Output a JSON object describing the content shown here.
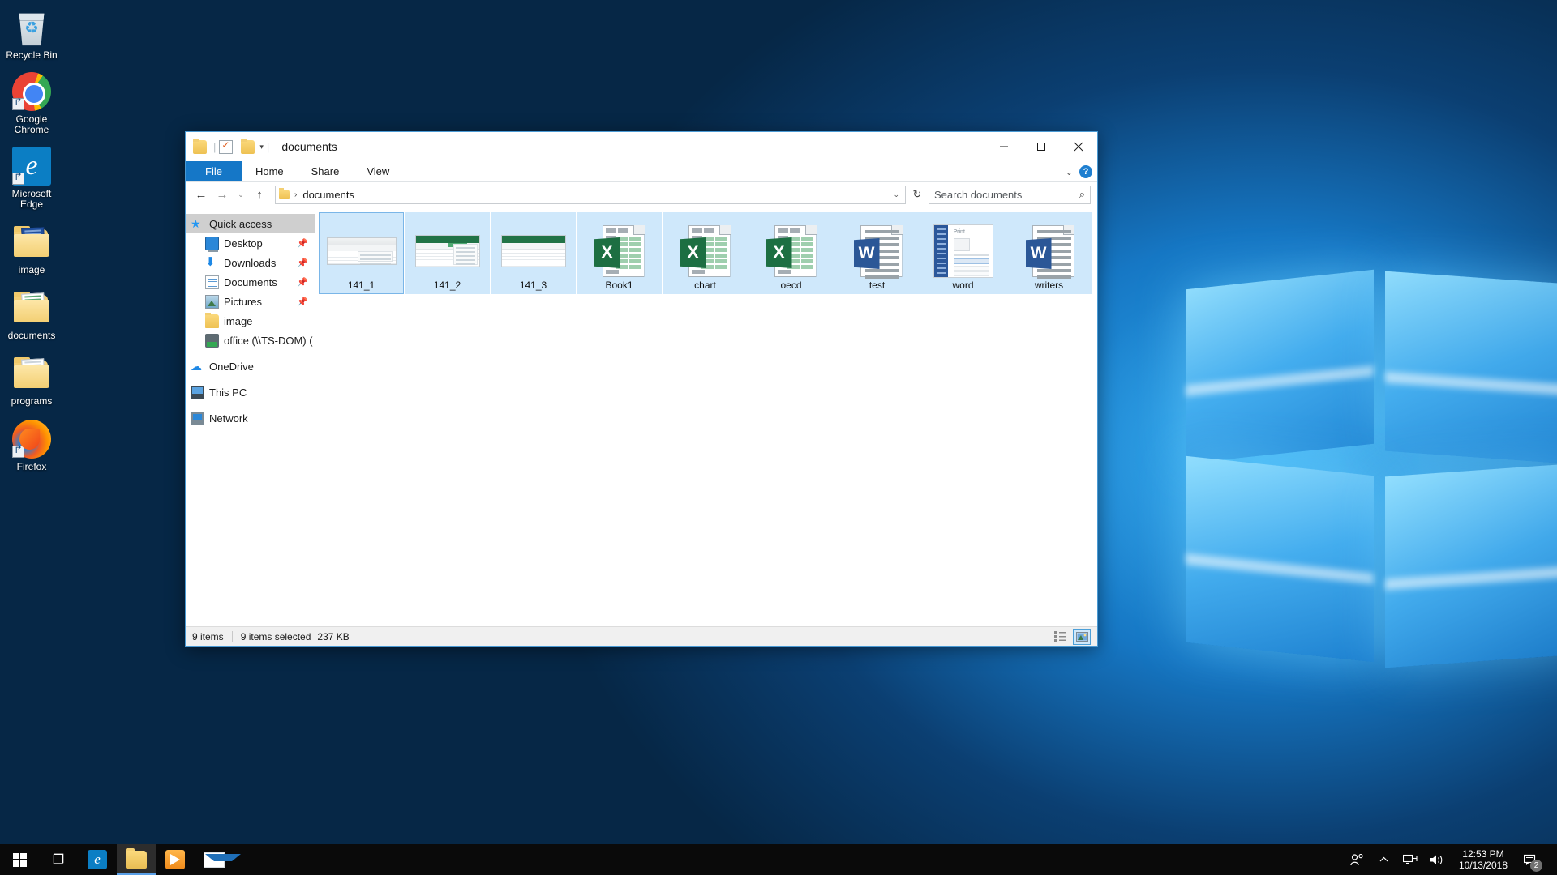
{
  "desktop": {
    "icons": [
      {
        "label": "Recycle Bin",
        "icon": "recycle-bin-icon"
      },
      {
        "label": "Google Chrome",
        "icon": "chrome-icon"
      },
      {
        "label": "Microsoft Edge",
        "icon": "edge-icon"
      },
      {
        "label": "image",
        "icon": "folder-icon"
      },
      {
        "label": "documents",
        "icon": "folder-icon"
      },
      {
        "label": "programs",
        "icon": "folder-icon"
      },
      {
        "label": "Firefox",
        "icon": "firefox-icon"
      }
    ]
  },
  "explorer": {
    "title": "documents",
    "quick_access_toolbar": {
      "folder_icon": "folder-icon",
      "properties_icon": "properties-icon",
      "new_folder_icon": "new-folder-icon",
      "customize_caret": "▾"
    },
    "window_controls": {
      "minimize": "minimize-icon",
      "maximize": "maximize-icon",
      "close": "close-icon"
    },
    "ribbon": {
      "tabs": [
        "File",
        "Home",
        "Share",
        "View"
      ],
      "collapse_caret": "⌄",
      "help_label": "?"
    },
    "address_bar": {
      "back": "←",
      "forward": "→",
      "recent": "⌄",
      "up": "↑",
      "crumb_folder_icon": "folder-icon",
      "crumb_separator": "›",
      "path": "documents",
      "dropdown_caret": "⌄",
      "refresh": "↻"
    },
    "search": {
      "placeholder": "Search documents",
      "value": "",
      "icon": "search-icon"
    },
    "nav_pane": {
      "items": [
        {
          "label": "Quick access",
          "icon": "quick-access-star-icon",
          "selected": true,
          "child": false,
          "pinned": false
        },
        {
          "label": "Desktop",
          "icon": "desktop-icon",
          "selected": false,
          "child": true,
          "pinned": true
        },
        {
          "label": "Downloads",
          "icon": "downloads-icon",
          "selected": false,
          "child": true,
          "pinned": true
        },
        {
          "label": "Documents",
          "icon": "documents-icon",
          "selected": false,
          "child": true,
          "pinned": true
        },
        {
          "label": "Pictures",
          "icon": "pictures-icon",
          "selected": false,
          "child": true,
          "pinned": true
        },
        {
          "label": "image",
          "icon": "folder-icon",
          "selected": false,
          "child": true,
          "pinned": false
        },
        {
          "label": "office (\\\\TS-DOM) (",
          "icon": "network-drive-icon",
          "selected": false,
          "child": true,
          "pinned": false
        },
        {
          "label": "OneDrive",
          "icon": "onedrive-icon",
          "selected": false,
          "child": false,
          "pinned": false
        },
        {
          "label": "This PC",
          "icon": "this-pc-icon",
          "selected": false,
          "child": false,
          "pinned": false
        },
        {
          "label": "Network",
          "icon": "network-icon",
          "selected": false,
          "child": false,
          "pinned": false
        }
      ]
    },
    "files": [
      {
        "name": "141_1",
        "type": "excel-screenshot-thumbnail",
        "selected": true,
        "focused": true
      },
      {
        "name": "141_2",
        "type": "excel-screenshot-thumbnail",
        "selected": true,
        "focused": false
      },
      {
        "name": "141_3",
        "type": "excel-screenshot-thumbnail",
        "selected": true,
        "focused": false
      },
      {
        "name": "Book1",
        "type": "excel-file-icon",
        "selected": true,
        "focused": false
      },
      {
        "name": "chart",
        "type": "excel-file-icon",
        "selected": true,
        "focused": false
      },
      {
        "name": "oecd",
        "type": "excel-file-icon",
        "selected": true,
        "focused": false
      },
      {
        "name": "test",
        "type": "word-file-icon",
        "selected": true,
        "focused": false
      },
      {
        "name": "word",
        "type": "word-screenshot-thumbnail",
        "selected": true,
        "focused": false
      },
      {
        "name": "writers",
        "type": "word-file-icon",
        "selected": true,
        "focused": false
      }
    ],
    "status_bar": {
      "item_count": "9 items",
      "selection": "9 items selected",
      "size": "237 KB",
      "details_view_icon": "details-view-icon",
      "large_icons_view_icon": "large-icons-view-icon",
      "active_view": "large-icons-view-icon"
    }
  },
  "taskbar": {
    "start_label": "start-icon",
    "items": [
      {
        "name": "task-view",
        "icon": "task-view-icon",
        "active": false
      },
      {
        "name": "microsoft-edge",
        "icon": "edge-icon",
        "active": false
      },
      {
        "name": "file-explorer",
        "icon": "file-explorer-icon",
        "active": true
      },
      {
        "name": "microsoft-store",
        "icon": "store-icon",
        "active": false
      },
      {
        "name": "mail",
        "icon": "mail-icon",
        "active": false
      }
    ],
    "tray": {
      "people_icon": "people-icon",
      "show_hidden_icon": "chevron-up-icon",
      "network_icon": "network-icon",
      "volume_icon": "volume-icon",
      "time": "12:53 PM",
      "date": "10/13/2018",
      "notification_icon": "notification-icon",
      "notification_count": "2"
    }
  }
}
